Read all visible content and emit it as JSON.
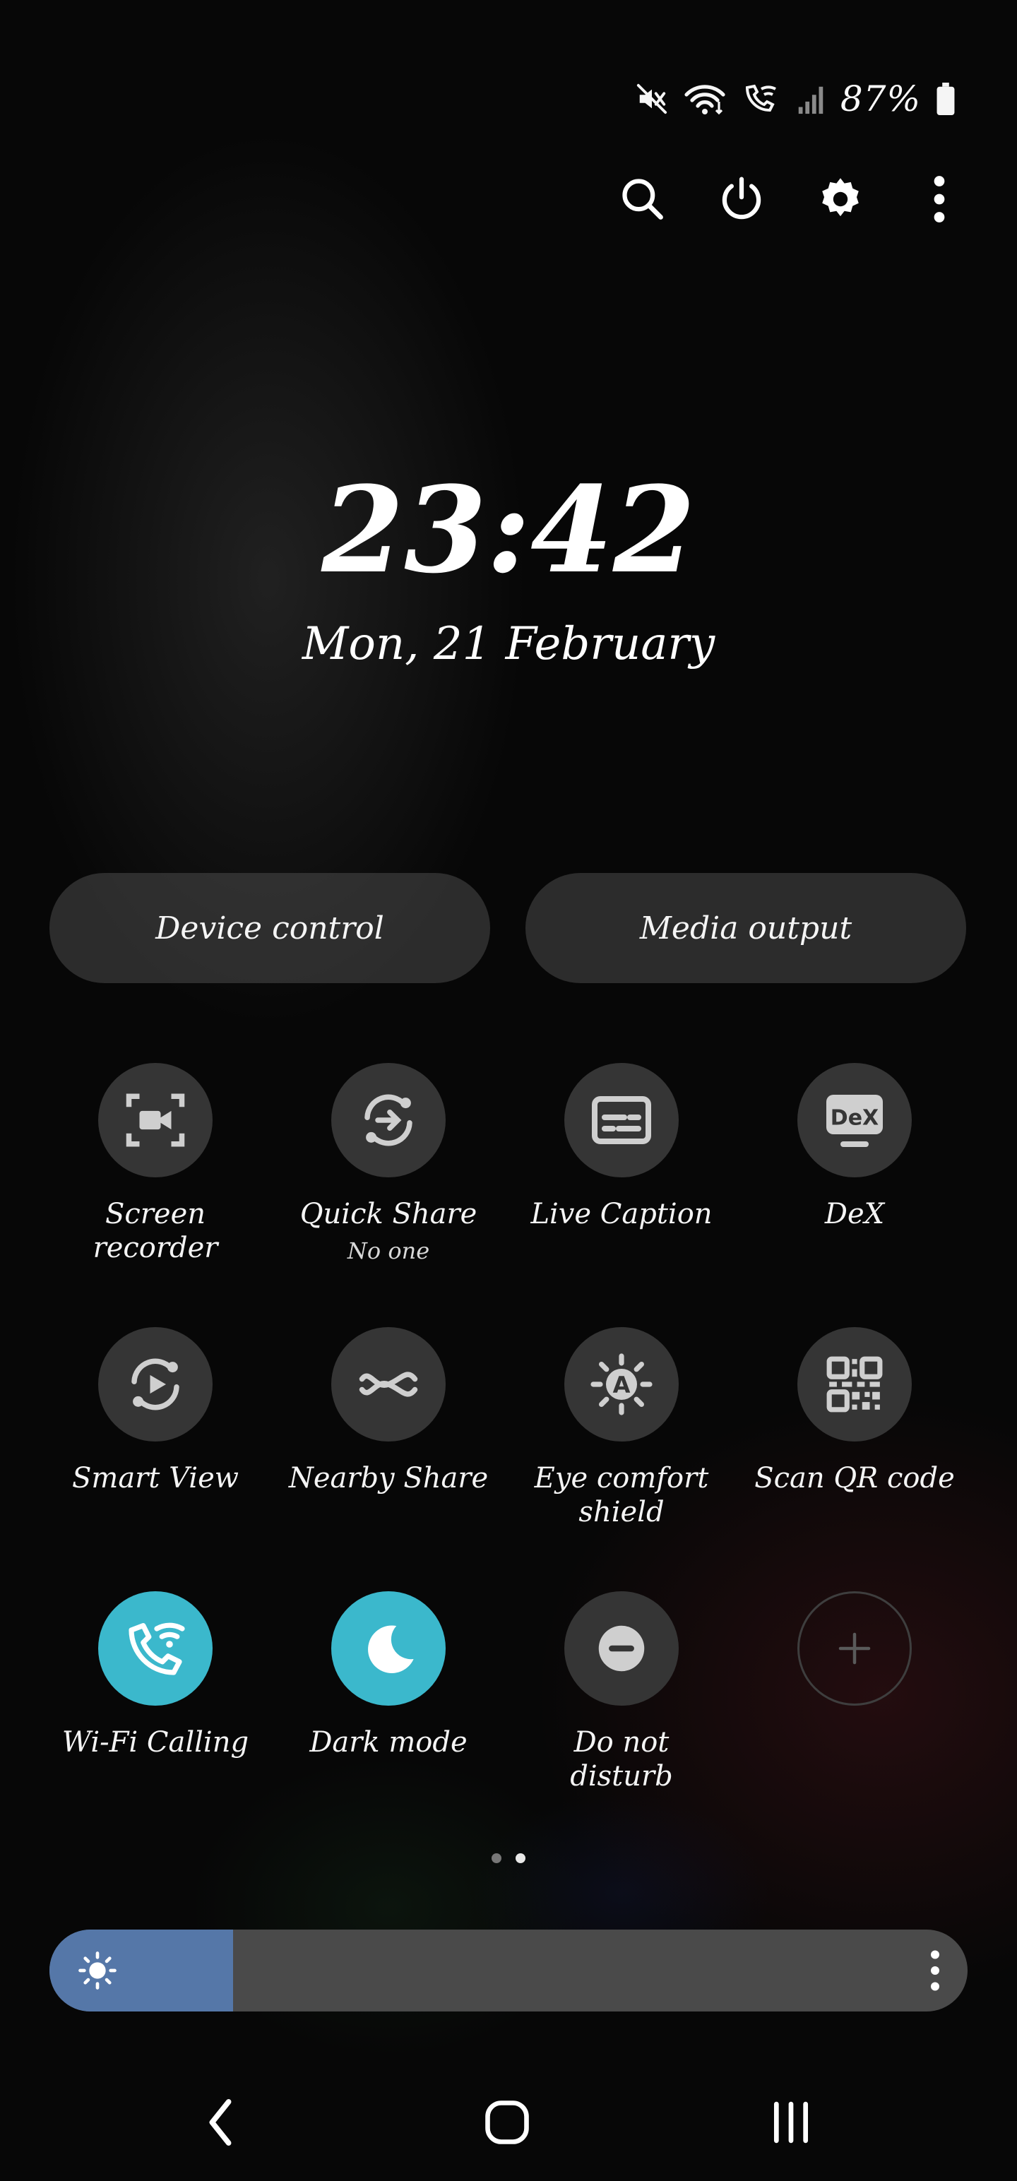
{
  "status_bar": {
    "battery_text": "87%",
    "icons": [
      "mute-icon",
      "wifi-icon",
      "wifi-calling-icon",
      "signal-icon",
      "battery-icon"
    ]
  },
  "top_actions": [
    "search-icon",
    "power-icon",
    "gear-icon",
    "more-vert-icon"
  ],
  "clock": {
    "time": "23:42",
    "date": "Mon, 21 February"
  },
  "pills": {
    "device_control": "Device control",
    "media_output": "Media output"
  },
  "tiles": [
    {
      "label": "Screen\nrecorder",
      "sub": "",
      "icon": "screen-recorder-icon",
      "active": false
    },
    {
      "label": "Quick Share",
      "sub": "No one",
      "icon": "quick-share-icon",
      "active": false
    },
    {
      "label": "Live Caption",
      "sub": "",
      "icon": "live-caption-icon",
      "active": false
    },
    {
      "label": "DeX",
      "sub": "",
      "icon": "dex-icon",
      "active": false
    },
    {
      "label": "Smart View",
      "sub": "",
      "icon": "smart-view-icon",
      "active": false
    },
    {
      "label": "Nearby Share",
      "sub": "",
      "icon": "nearby-share-icon",
      "active": false
    },
    {
      "label": "Eye comfort\nshield",
      "sub": "",
      "icon": "eye-comfort-icon",
      "active": false
    },
    {
      "label": "Scan QR code",
      "sub": "",
      "icon": "qr-code-icon",
      "active": false
    },
    {
      "label": "Wi-Fi Calling",
      "sub": "",
      "icon": "wifi-calling-icon",
      "active": true
    },
    {
      "label": "Dark mode",
      "sub": "",
      "icon": "moon-icon",
      "active": true
    },
    {
      "label": "Do not\ndisturb",
      "sub": "",
      "icon": "do-not-disturb-icon",
      "active": false
    },
    {
      "label": "",
      "sub": "",
      "icon": "plus-icon",
      "active": false
    }
  ],
  "page_indicator": {
    "count": 2,
    "active": 1
  },
  "brightness": {
    "level": 0.2
  },
  "colors": {
    "accent": "#3bb8cc",
    "brightness_fill": "#5577a8",
    "tile_bg": "#353535"
  },
  "nav": [
    "back-icon",
    "home-icon",
    "recents-icon"
  ]
}
